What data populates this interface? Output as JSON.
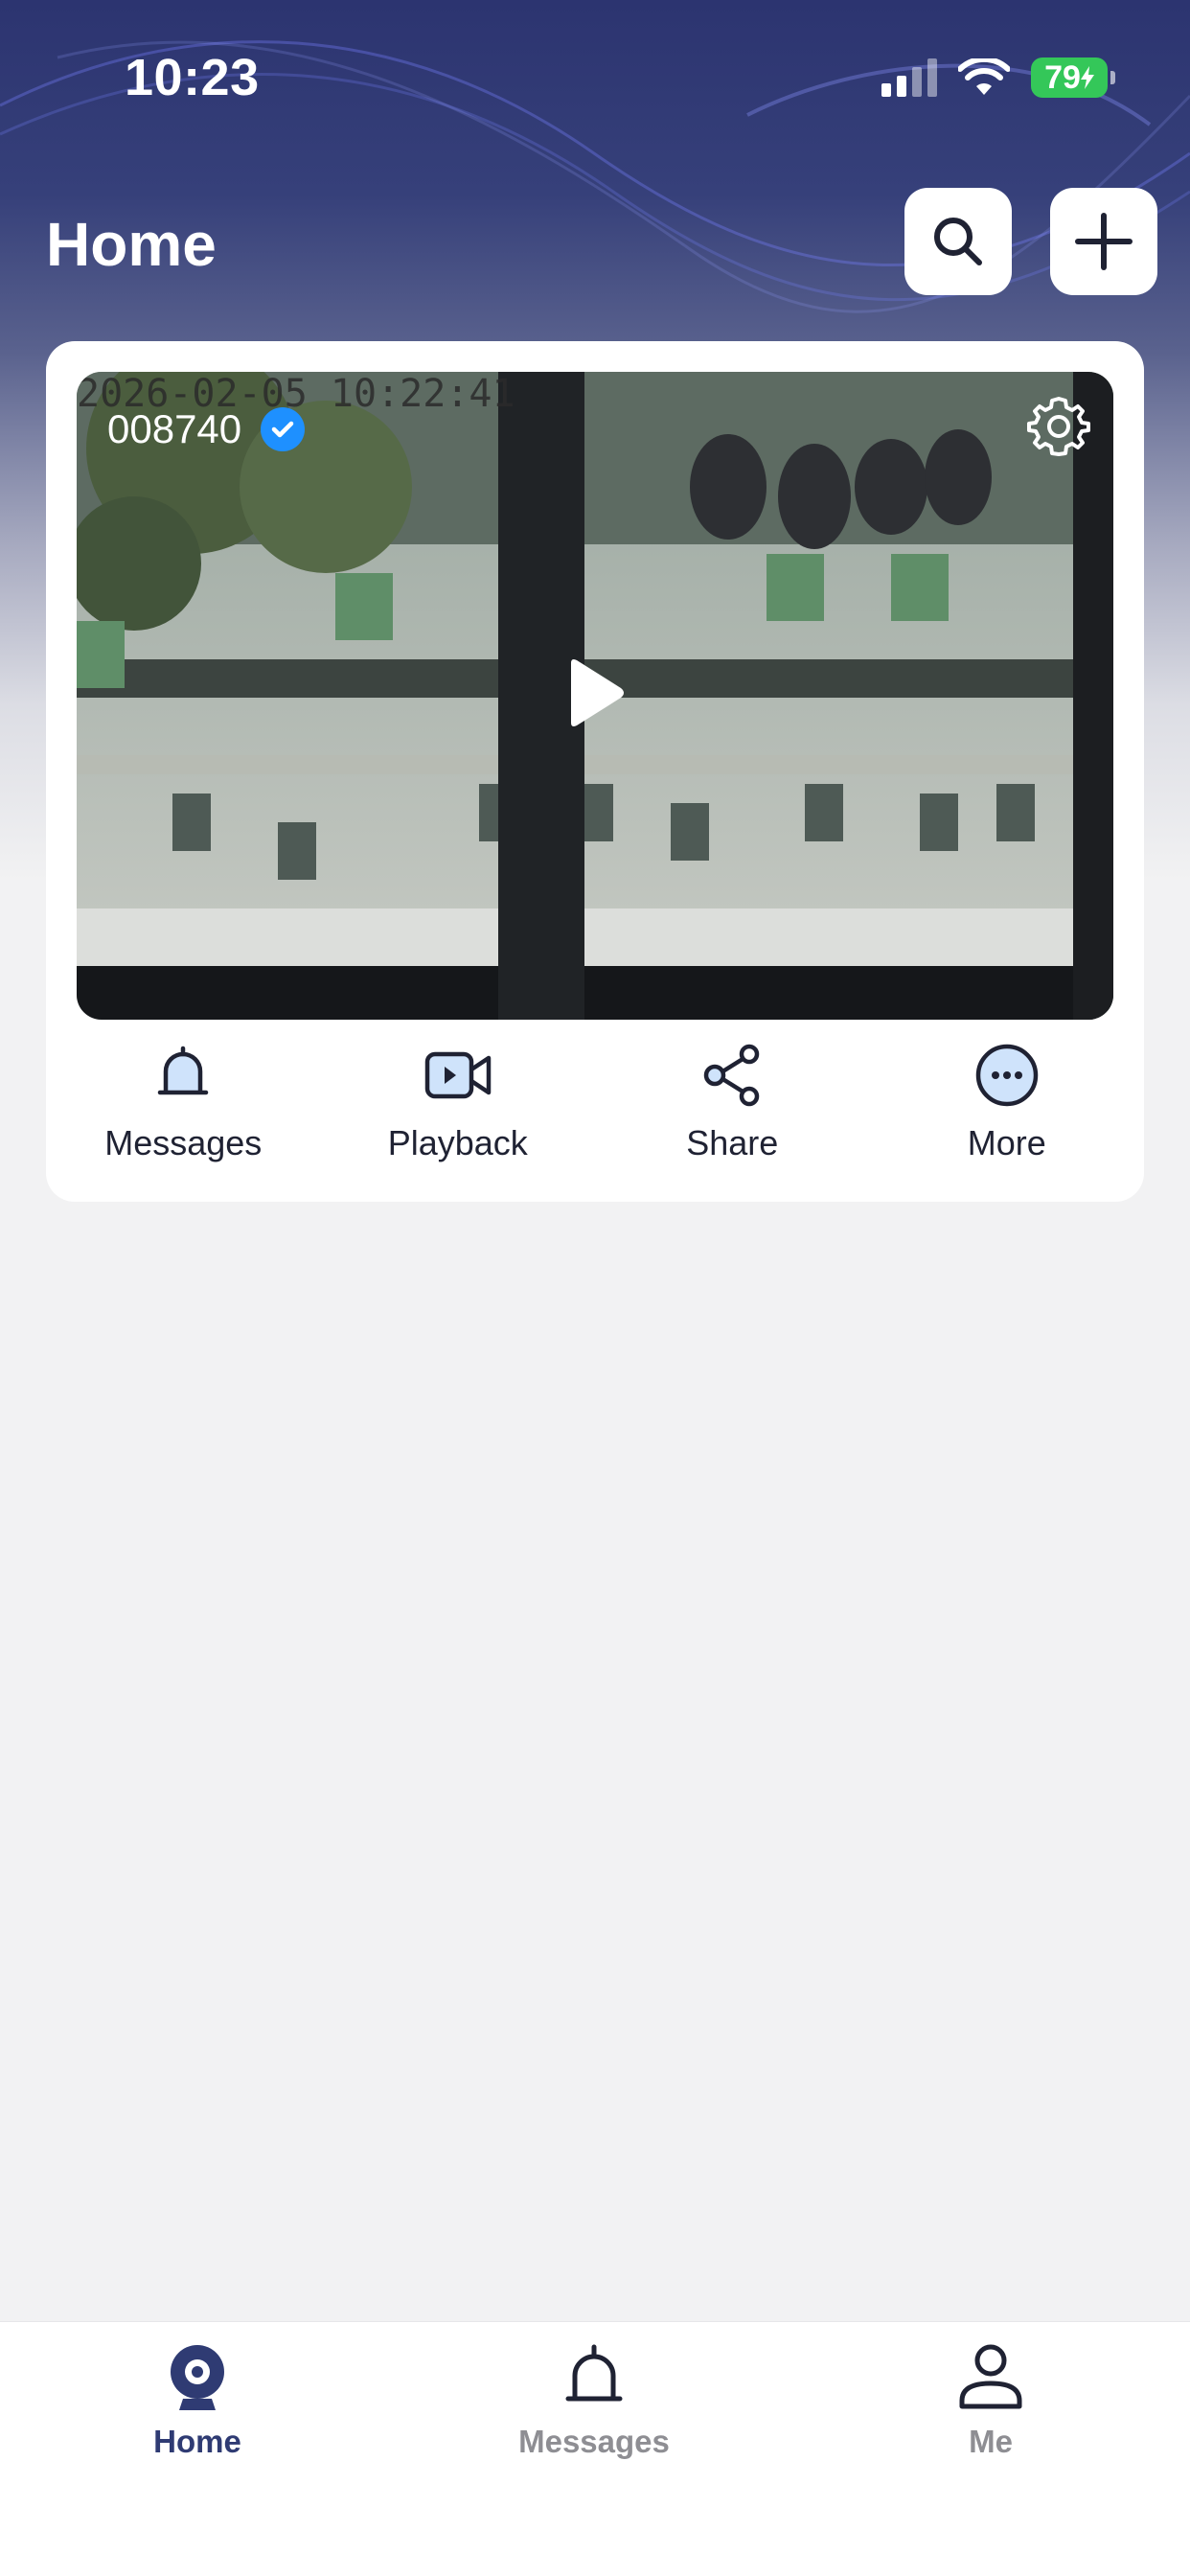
{
  "status_bar": {
    "time": "10:23",
    "battery": "79"
  },
  "header": {
    "title": "Home",
    "search_icon": "search-icon",
    "add_icon": "plus-icon"
  },
  "device_card": {
    "osd_timestamp": "2026-02-05 10:22:41",
    "device_name": "008740",
    "verified_icon": "check-badge-icon",
    "settings_icon": "gear-icon",
    "play_icon": "play-icon",
    "actions": [
      {
        "label": "Messages",
        "icon": "bell-icon"
      },
      {
        "label": "Playback",
        "icon": "video-camera-icon"
      },
      {
        "label": "Share",
        "icon": "share-icon"
      },
      {
        "label": "More",
        "icon": "more-dots-icon"
      }
    ]
  },
  "tab_bar": {
    "tabs": [
      {
        "label": "Home",
        "icon": "camera-icon",
        "active": true
      },
      {
        "label": "Messages",
        "icon": "bell-icon",
        "active": false
      },
      {
        "label": "Me",
        "icon": "user-icon",
        "active": false
      }
    ]
  },
  "colors": {
    "header_bg": "#2c3470",
    "accent": "#2f3b73",
    "inactive_tab": "#8e8e93",
    "verified": "#1e90ff",
    "battery": "#34c759"
  }
}
